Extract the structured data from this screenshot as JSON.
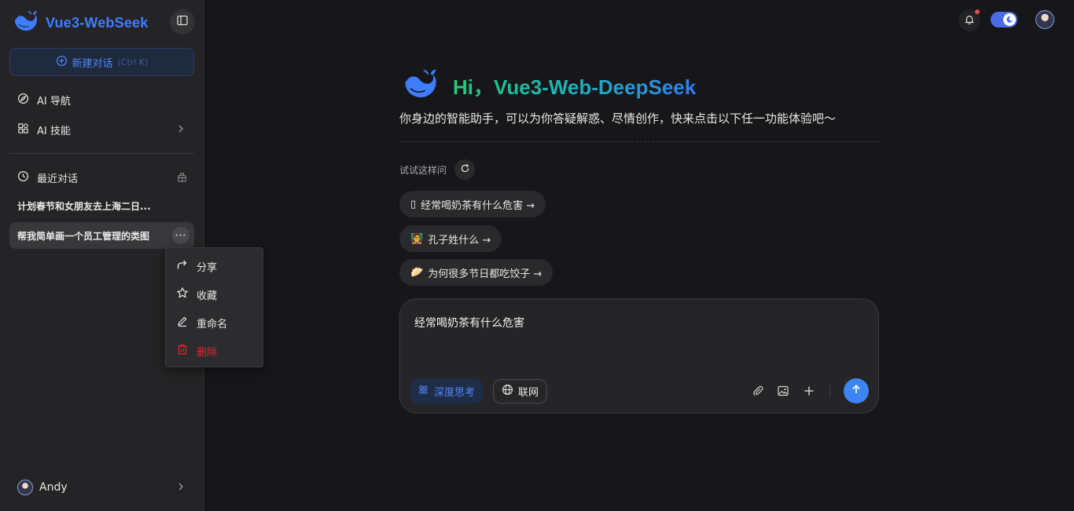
{
  "app": {
    "title": "Vue3-WebSeek"
  },
  "sidebar": {
    "new_chat": {
      "label": "新建对话",
      "shortcut": "(Ctrl K)"
    },
    "nav": [
      {
        "label": "AI 导航",
        "icon": "compass-icon"
      },
      {
        "label": "AI 技能",
        "icon": "apps-icon"
      }
    ],
    "recent": {
      "heading": "最近对话",
      "items": [
        {
          "label": "计划春节和女朋友去上海二日..."
        },
        {
          "label": "帮我简单画一个员工管理的类图",
          "more": "···"
        }
      ]
    },
    "context_menu": [
      {
        "label": "分享",
        "icon": "share-icon"
      },
      {
        "label": "收藏",
        "icon": "star-icon"
      },
      {
        "label": "重命名",
        "icon": "edit-icon"
      },
      {
        "label": "删除",
        "icon": "trash-icon"
      }
    ],
    "user": {
      "name": "Andy"
    }
  },
  "main": {
    "hero_title": "Hi，Vue3-Web-DeepSeek",
    "subtitle": "你身边的智能助手，可以为你答疑解惑、尽情创作，快来点击以下任一功能体验吧～",
    "try_label": "试试这样问",
    "suggestions": [
      {
        "emoji": "▯",
        "label": "经常喝奶茶有什么危害 →"
      },
      {
        "emoji": "🧑‍🏫",
        "label": "孔子姓什么 →"
      },
      {
        "emoji": "🥟",
        "label": "为何很多节日都吃饺子 →"
      }
    ],
    "composer": {
      "text": "经常喝奶茶有什么危害",
      "deep_think": "深度思考",
      "web_search": "联网"
    }
  },
  "colors": {
    "accent": "#3d85f4",
    "brand": "#3f7dff",
    "danger": "#e0262a",
    "notification_dot": "#e05050"
  }
}
